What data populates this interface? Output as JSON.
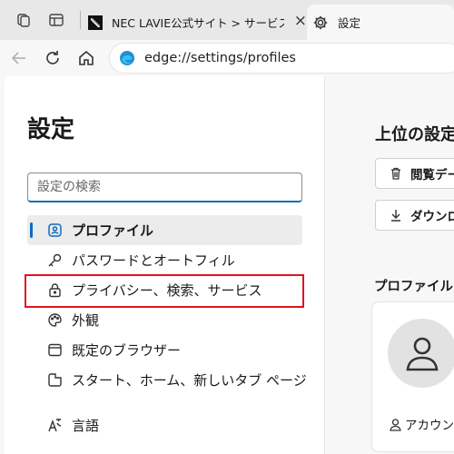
{
  "tabs": [
    {
      "title": "NEC LAVIE公式サイト > サービス&サ",
      "close": "×"
    },
    {
      "title": "設定"
    }
  ],
  "address_bar": {
    "url": "edge://settings/profiles"
  },
  "sidebar": {
    "title": "設定",
    "search_placeholder": "設定の検索",
    "items": [
      {
        "label": "プロファイル",
        "icon": "profile-icon",
        "active": true
      },
      {
        "label": "パスワードとオートフィル",
        "icon": "key-icon"
      },
      {
        "label": "プライバシー、検索、サービス",
        "icon": "lock-icon",
        "highlighted": true
      },
      {
        "label": "外観",
        "icon": "palette-icon"
      },
      {
        "label": "既定のブラウザー",
        "icon": "browser-window-icon"
      },
      {
        "label": "スタート、ホーム、新しいタブ ページ",
        "icon": "new-tab-icon"
      },
      {
        "label": "言語",
        "icon": "language-icon"
      }
    ]
  },
  "content": {
    "section_title": "上位の設定",
    "buttons": [
      {
        "label": "閲覧データ",
        "icon": "trash-icon"
      },
      {
        "label": "ダウンロード",
        "icon": "download-icon"
      }
    ],
    "profiles_heading": "プロファイル",
    "account_label": "アカウント"
  },
  "colors": {
    "accent": "#0f6cbd",
    "highlight_border": "#e0141e",
    "tab_strip": "#e8e8e8"
  }
}
